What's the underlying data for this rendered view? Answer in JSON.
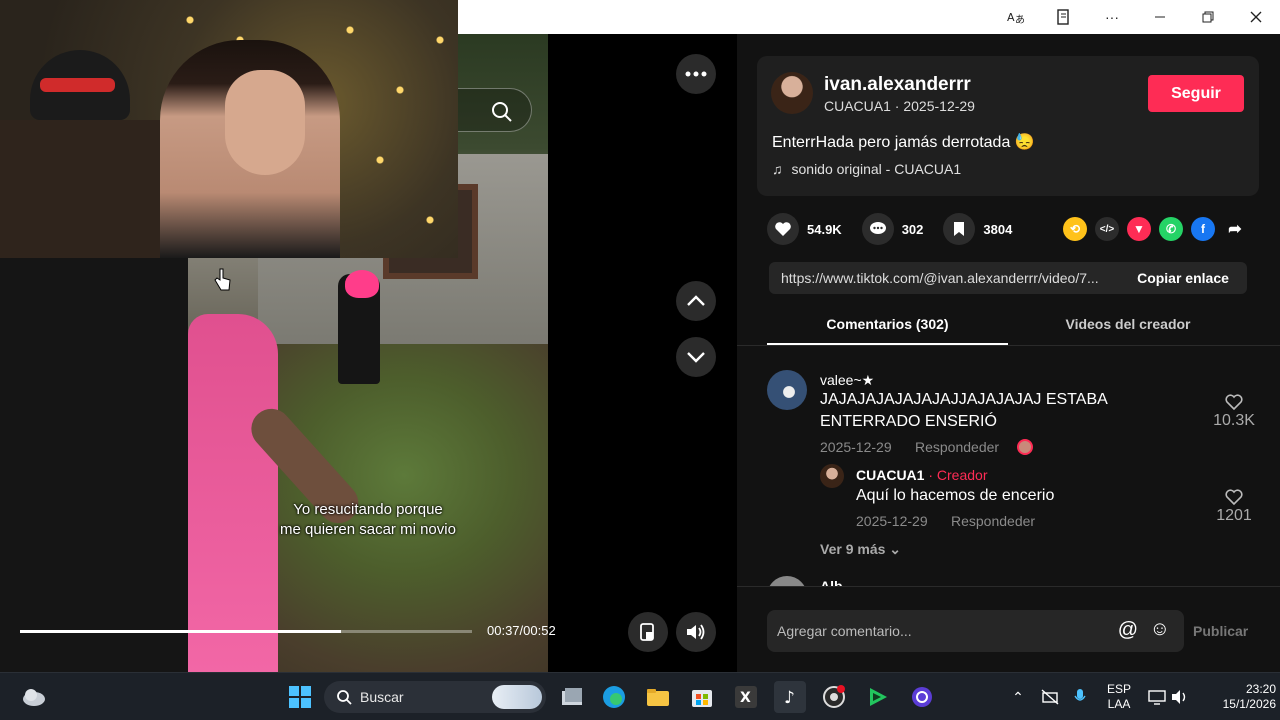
{
  "browser": {
    "controls": [
      "translate-icon",
      "reader-icon",
      "more-icon",
      "minimize-icon",
      "restore-icon",
      "close-icon"
    ]
  },
  "video": {
    "subtitle_line1": "Yo resucitando porque",
    "subtitle_line2": "me quieren sacar mi novio",
    "time": "00:37/00:52",
    "progress": 0.71
  },
  "post": {
    "username": "ivan.alexanderrr",
    "meta": "CUACUA1 · 2025-12-29",
    "follow_label": "Seguir",
    "description": "EnterrHada pero jamás derrotada 😓",
    "music": "sonido original - CUACUA1",
    "likes": "54.9K",
    "comments": "302",
    "saves": "3804",
    "link": "https://www.tiktok.com/@ivan.alexanderrr/video/7...",
    "copy_label": "Copiar enlace"
  },
  "tabs": {
    "comments": "Comentarios (302)",
    "creator_videos": "Videos del creador"
  },
  "comments": [
    {
      "name": "valee~★",
      "text_line1": "JAJAJAJAJAJAJAJJAJAJAJAJ ESTABA",
      "text_line2": "ENTERRADO ENSERIÓ",
      "date": "2025-12-29",
      "reply_label": "Respondeder",
      "likes": "10.3K"
    },
    {
      "name": "CUACUA1",
      "badge": "Creador",
      "separator": " · ",
      "text": "Aquí lo hacemos de encerio",
      "date": "2025-12-29",
      "reply_label": "Respondeder",
      "likes": "1201"
    }
  ],
  "more_replies": "Ver 9 más",
  "next_comment_partial": "Alb",
  "comment_input": {
    "placeholder": "Agregar comentario...",
    "publish": "Publicar"
  },
  "taskbar": {
    "search_placeholder": "Buscar",
    "lang_line1": "ESP",
    "lang_line2": "LAA",
    "time": "23:20",
    "date": "15/1/2026"
  },
  "colors": {
    "accent": "#fe2c55",
    "panel": "#121212"
  }
}
